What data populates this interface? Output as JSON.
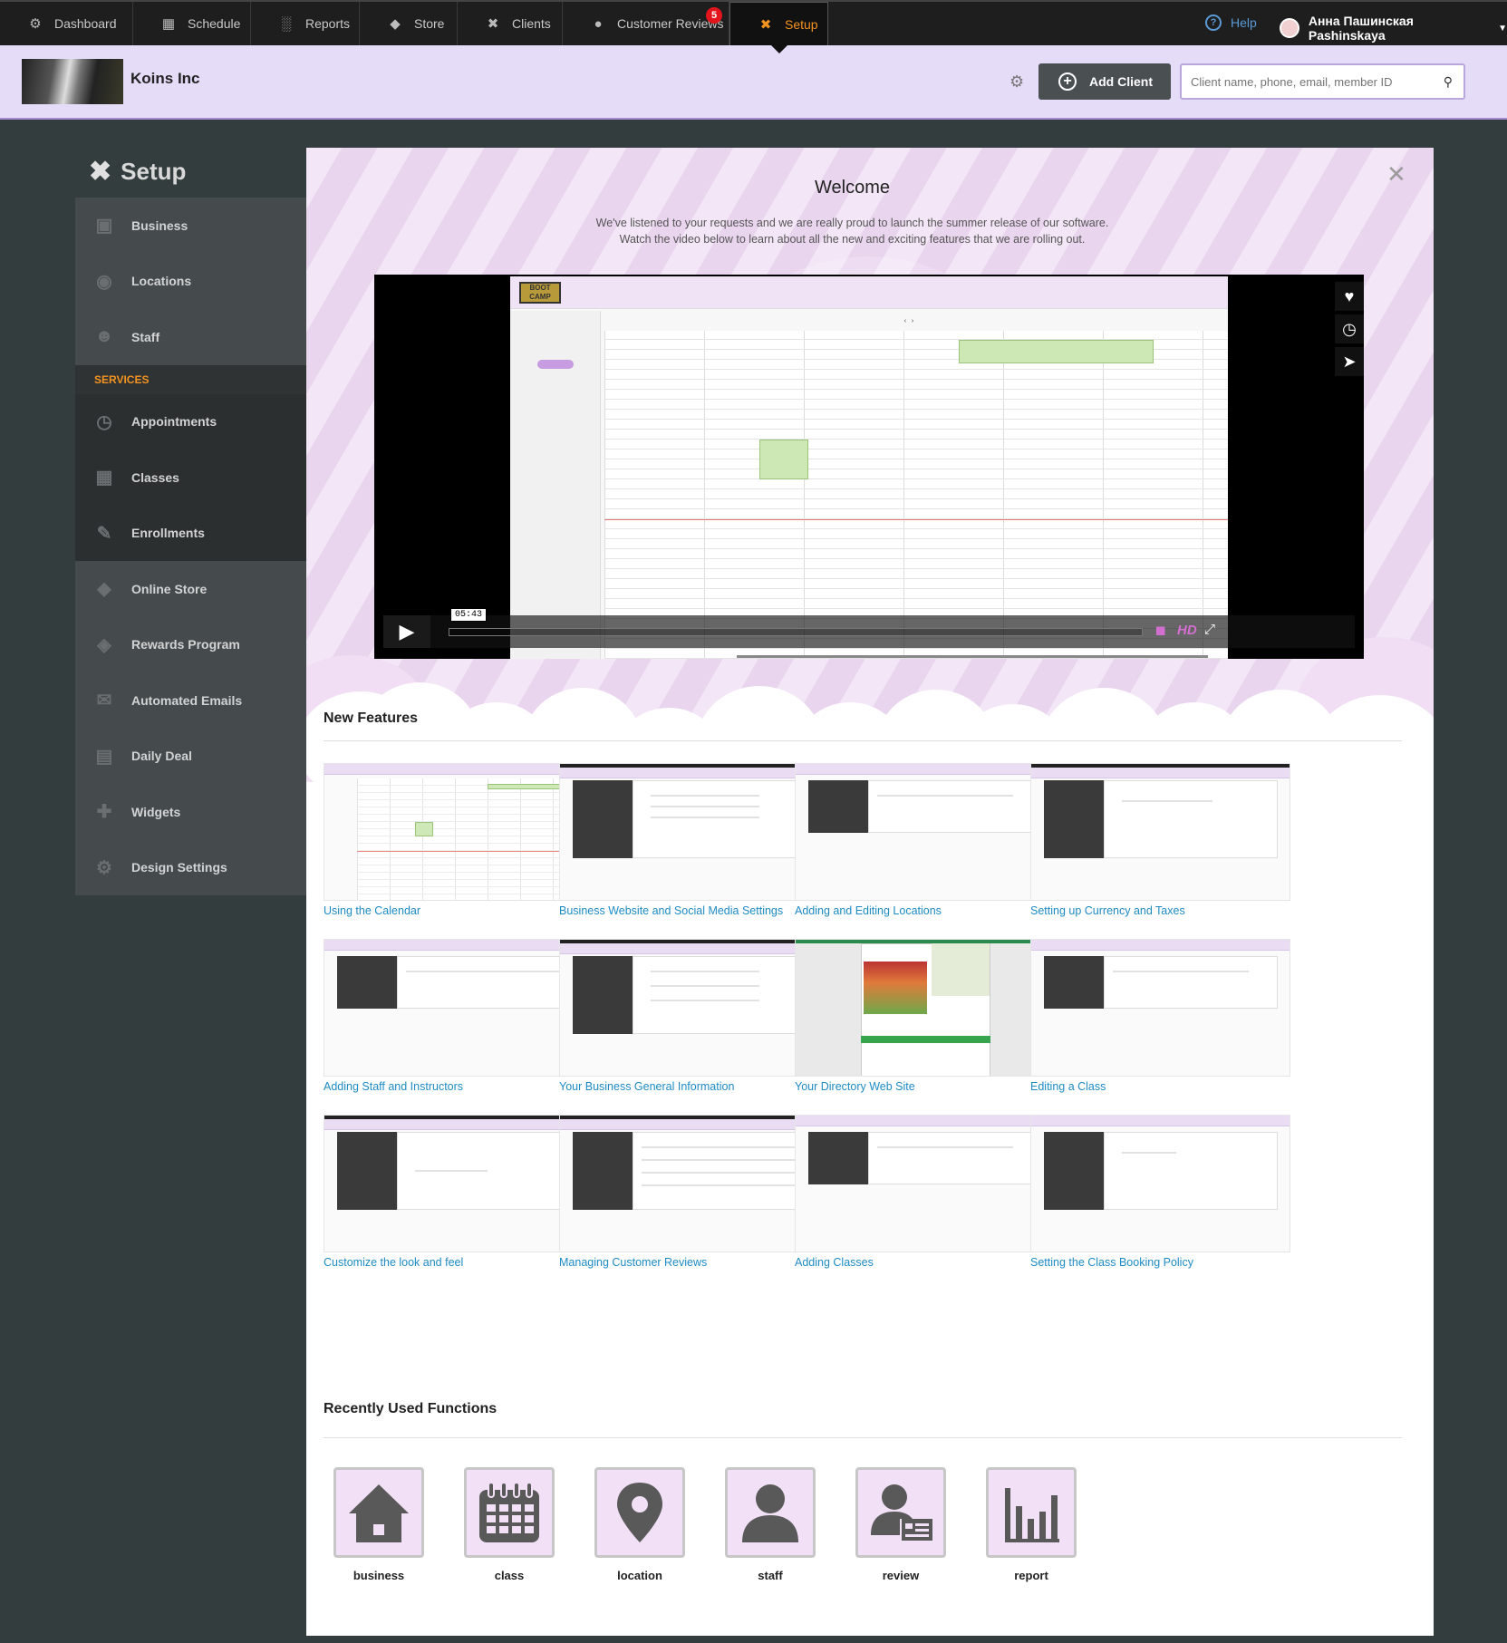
{
  "nav": {
    "tabs": [
      {
        "label": "Dashboard",
        "icon": "dashboard-icon"
      },
      {
        "label": "Schedule",
        "icon": "calendar-icon"
      },
      {
        "label": "Reports",
        "icon": "bar-chart-icon"
      },
      {
        "label": "Store",
        "icon": "tag-icon"
      },
      {
        "label": "Clients",
        "icon": "tools-icon"
      },
      {
        "label": "Customer Reviews",
        "icon": "speech-bubble-icon"
      },
      {
        "label": "Setup",
        "icon": "setup-tools-icon"
      }
    ],
    "reviews_badge": "5",
    "active_tab": "Setup",
    "active_color": "#f4931f",
    "help_label": "Help",
    "user_name": "Анна Пашинская Pashinskaya"
  },
  "header": {
    "company": "Koins Inc",
    "add_client_label": "Add Client",
    "search_placeholder": "Client name, phone, email, member ID",
    "accent_color": "#e5dcf8"
  },
  "sidebar": {
    "title": "Setup",
    "items": [
      {
        "label": "Business",
        "icon": "briefcase-icon"
      },
      {
        "label": "Locations",
        "icon": "map-pin-icon"
      },
      {
        "label": "Staff",
        "icon": "staff-icon"
      }
    ],
    "section_label": "SERVICES",
    "service_items": [
      {
        "label": "Appointments",
        "icon": "clock-icon"
      },
      {
        "label": "Classes",
        "icon": "classes-icon"
      },
      {
        "label": "Enrollments",
        "icon": "edit-icon"
      }
    ],
    "more_items": [
      {
        "label": "Online Store",
        "icon": "tag-icon"
      },
      {
        "label": "Rewards Program",
        "icon": "reward-tag-icon"
      },
      {
        "label": "Automated Emails",
        "icon": "envelope-icon"
      },
      {
        "label": "Daily Deal",
        "icon": "calendar-icon"
      },
      {
        "label": "Widgets",
        "icon": "plus-icon"
      },
      {
        "label": "Design Settings",
        "icon": "gear-icon"
      }
    ]
  },
  "welcome": {
    "title": "Welcome",
    "intro_line1": "We've listened to your requests and we are really proud to launch the summer release of our software.",
    "intro_line2": "Watch the video below to learn about all the new and exciting features that we are rolling out."
  },
  "video": {
    "time": "05:43",
    "hd_label": "HD",
    "progress": 0.0
  },
  "new_features": {
    "title": "New Features",
    "items": [
      {
        "label": "Using the Calendar",
        "thumb": "calendar"
      },
      {
        "label": "Business Website and Social Media Settings",
        "thumb": "form"
      },
      {
        "label": "Adding and Editing Locations",
        "thumb": "list"
      },
      {
        "label": "Setting up Currency and Taxes",
        "thumb": "form"
      },
      {
        "label": "Adding Staff and Instructors",
        "thumb": "list"
      },
      {
        "label": "Your Business General Information",
        "thumb": "form"
      },
      {
        "label": "Your Directory Web Site",
        "thumb": "directory"
      },
      {
        "label": "Editing a Class",
        "thumb": "list"
      },
      {
        "label": "Customize the look and feel",
        "thumb": "form"
      },
      {
        "label": "Managing Customer Reviews",
        "thumb": "table"
      },
      {
        "label": "Adding Classes",
        "thumb": "list"
      },
      {
        "label": "Setting the Class Booking Policy",
        "thumb": "form"
      }
    ]
  },
  "recent": {
    "title": "Recently Used Functions",
    "items": [
      {
        "label": "business",
        "icon": "house-icon"
      },
      {
        "label": "class",
        "icon": "calendar-icon"
      },
      {
        "label": "location",
        "icon": "map-pin-icon"
      },
      {
        "label": "staff",
        "icon": "person-icon"
      },
      {
        "label": "review",
        "icon": "id-card-icon"
      },
      {
        "label": "report",
        "icon": "bar-chart-icon"
      }
    ]
  }
}
